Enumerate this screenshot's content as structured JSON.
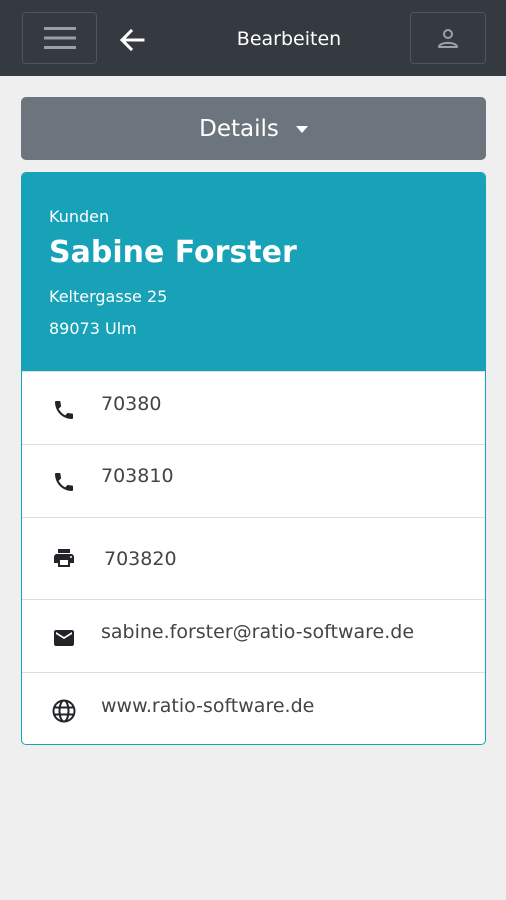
{
  "header": {
    "title": "Bearbeiten",
    "icons": {
      "menu": "hamburger-menu-icon",
      "back": "arrow-left-icon",
      "user": "user-icon"
    }
  },
  "details_button": {
    "label": "Details"
  },
  "card": {
    "category": "Kunden",
    "name": "Sabine Forster",
    "street": "Keltergasse 25",
    "city": "89073 Ulm",
    "contacts": [
      {
        "icon": "phone-icon",
        "value": "70380"
      },
      {
        "icon": "phone-icon",
        "value": "703810"
      },
      {
        "icon": "fax-icon",
        "value": "703820"
      },
      {
        "icon": "email-icon",
        "value": "sabine.forster@ratio-software.de"
      },
      {
        "icon": "globe-icon",
        "value": "www.ratio-software.de"
      }
    ]
  },
  "colors": {
    "topbar": "#343a40",
    "button_secondary": "#6c757d",
    "accent": "#17a2b8",
    "background": "#efefef"
  }
}
